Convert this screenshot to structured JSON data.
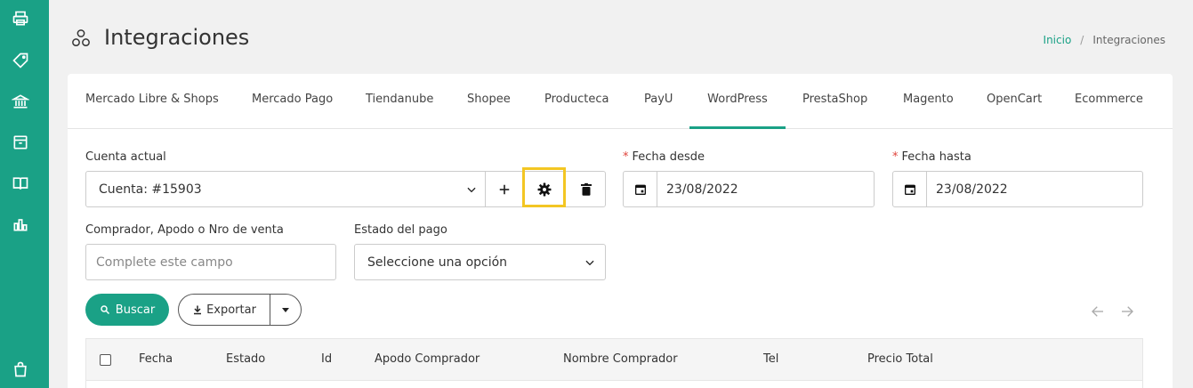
{
  "sidebar": {
    "items": [
      {
        "icon": "printer-icon"
      },
      {
        "icon": "tag-icon"
      },
      {
        "icon": "bank-icon"
      },
      {
        "icon": "box-icon"
      },
      {
        "icon": "book-icon"
      },
      {
        "icon": "bar-chart-icon"
      },
      {
        "icon": "shopping-bag-icon"
      }
    ],
    "color": "#1aa186"
  },
  "header": {
    "title": "Integraciones",
    "icon": "integrations-icon",
    "breadcrumb": {
      "home": "Inicio",
      "separator": "/",
      "current": "Integraciones"
    }
  },
  "tabs": [
    {
      "label": "Mercado Libre & Shops"
    },
    {
      "label": "Mercado Pago"
    },
    {
      "label": "Tiendanube"
    },
    {
      "label": "Shopee"
    },
    {
      "label": "Producteca"
    },
    {
      "label": "PayU"
    },
    {
      "label": "WordPress",
      "active": true
    },
    {
      "label": "PrestaShop"
    },
    {
      "label": "Magento"
    },
    {
      "label": "OpenCart"
    },
    {
      "label": "Ecommerce"
    }
  ],
  "form": {
    "account_label": "Cuenta actual",
    "account_value": "Cuenta: #15903",
    "date_from_label": "Fecha desde",
    "date_from_value": "23/08/2022",
    "date_to_label": "Fecha hasta",
    "date_to_value": "23/08/2022",
    "required_mark": "*",
    "buyer_label": "Comprador, Apodo o Nro de venta",
    "buyer_placeholder": "Complete este campo",
    "payment_label": "Estado del pago",
    "payment_value": "Seleccione una opción"
  },
  "actions": {
    "search": "Buscar",
    "export": "Exportar"
  },
  "table": {
    "columns": [
      "Fecha",
      "Estado",
      "Id",
      "Apodo Comprador",
      "Nombre Comprador",
      "Tel",
      "Precio Total"
    ]
  },
  "colors": {
    "accent": "#1aa186",
    "highlight": "#f3c623",
    "required": "#e0453c"
  }
}
